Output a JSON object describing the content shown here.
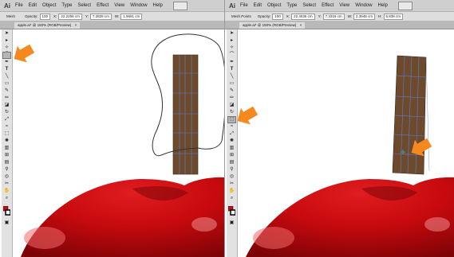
{
  "app_logo": "Ai",
  "menus": [
    "File",
    "Edit",
    "Object",
    "Type",
    "Select",
    "Effect",
    "View",
    "Window",
    "Help"
  ],
  "left": {
    "control_label": "Mesh",
    "opacity_label": "Opacity:",
    "opacity_value": "100",
    "x_label": "X:",
    "x_value": "22.2258 cm",
    "y_label": "Y:",
    "y_value": "7.2828 cm",
    "w_label": "W:",
    "w_value": "1.9691 cm",
    "doc_tab": "apple.ai* @ 150% (RGB/Preview)",
    "tab_close": "×",
    "highlighted_tool": "lasso-tool"
  },
  "right": {
    "control_label": "Mesh Points",
    "opacity_label": "Opacity:",
    "opacity_value": "100",
    "x_label": "X:",
    "x_value": "22.4035 cm",
    "y_label": "Y:",
    "y_value": "7.3318 cm",
    "w_label": "W:",
    "w_value": "2.3948 cm",
    "h_label": "H:",
    "h_value": "6.838 cm",
    "doc_tab": "apple.ai* @ 150% (RGB/Preview)",
    "tab_close": "×",
    "highlighted_tool": "direct-selection-tool"
  },
  "colors": {
    "stem": "#6e4a2c",
    "mesh_line": "#5b7fd6",
    "apple_red": "#d10f12",
    "apple_dark": "#8f0508",
    "callout_arrow": "#f5891f",
    "ui_gray": "#cfcfcf"
  },
  "icons": [
    "selection-arrow-icon",
    "direct-selection-icon",
    "lasso-icon",
    "pen-icon",
    "type-icon",
    "line-icon",
    "rectangle-icon",
    "brush-icon",
    "pencil-icon",
    "rotate-icon",
    "scale-icon",
    "mesh-icon",
    "eyedropper-icon",
    "zoom-icon",
    "hand-icon",
    "fill-stroke-icon"
  ]
}
